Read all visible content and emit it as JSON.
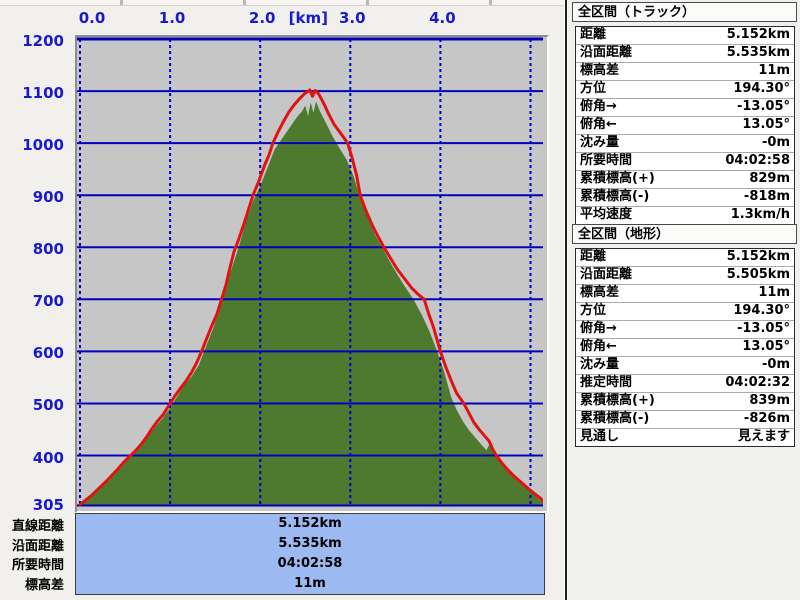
{
  "chart_data": {
    "type": "area",
    "title": "",
    "x_axis": {
      "unit_label": "[km]",
      "tick_labels": [
        "0.0",
        "1.0",
        "2.0",
        "3.0",
        "4.0"
      ],
      "tick_values": [
        0,
        1,
        2,
        3,
        4
      ],
      "gridline_values": [
        0,
        1,
        2,
        3,
        4,
        5
      ],
      "range_km": [
        0,
        5.17
      ]
    },
    "y_axis": {
      "unit": "m",
      "tick_labels": [
        "1200",
        "1100",
        "1000",
        "900",
        "800",
        "700",
        "600",
        "500",
        "400"
      ],
      "tick_values": [
        1200,
        1100,
        1000,
        900,
        800,
        700,
        600,
        500,
        400
      ],
      "base_label": "305",
      "range_m": [
        305,
        1200
      ]
    },
    "grid": true,
    "legend": "none",
    "series": [
      {
        "name": "terrain-profile",
        "type": "area",
        "color": "#4e7a30",
        "points": [
          [
            0.0,
            305
          ],
          [
            0.08,
            313
          ],
          [
            0.15,
            324
          ],
          [
            0.22,
            336
          ],
          [
            0.3,
            350
          ],
          [
            0.38,
            362
          ],
          [
            0.45,
            376
          ],
          [
            0.52,
            390
          ],
          [
            0.6,
            403
          ],
          [
            0.68,
            418
          ],
          [
            0.76,
            438
          ],
          [
            0.84,
            456
          ],
          [
            0.92,
            472
          ],
          [
            1.0,
            492
          ],
          [
            1.08,
            514
          ],
          [
            1.16,
            536
          ],
          [
            1.24,
            552
          ],
          [
            1.32,
            574
          ],
          [
            1.4,
            610
          ],
          [
            1.48,
            645
          ],
          [
            1.56,
            688
          ],
          [
            1.64,
            738
          ],
          [
            1.7,
            768
          ],
          [
            1.76,
            800
          ],
          [
            1.84,
            848
          ],
          [
            1.92,
            888
          ],
          [
            2.0,
            918
          ],
          [
            2.08,
            952
          ],
          [
            2.16,
            988
          ],
          [
            2.24,
            1008
          ],
          [
            2.32,
            1028
          ],
          [
            2.4,
            1048
          ],
          [
            2.46,
            1060
          ],
          [
            2.5,
            1072
          ],
          [
            2.53,
            1052
          ],
          [
            2.56,
            1078
          ],
          [
            2.59,
            1058
          ],
          [
            2.62,
            1080
          ],
          [
            2.66,
            1062
          ],
          [
            2.72,
            1042
          ],
          [
            2.8,
            1014
          ],
          [
            2.88,
            990
          ],
          [
            2.96,
            968
          ],
          [
            3.04,
            935
          ],
          [
            3.12,
            888
          ],
          [
            3.2,
            855
          ],
          [
            3.28,
            822
          ],
          [
            3.36,
            798
          ],
          [
            3.44,
            772
          ],
          [
            3.52,
            748
          ],
          [
            3.6,
            726
          ],
          [
            3.7,
            700
          ],
          [
            3.8,
            668
          ],
          [
            3.88,
            638
          ],
          [
            3.96,
            602
          ],
          [
            4.04,
            562
          ],
          [
            4.12,
            512
          ],
          [
            4.18,
            488
          ],
          [
            4.25,
            466
          ],
          [
            4.32,
            448
          ],
          [
            4.4,
            432
          ],
          [
            4.46,
            420
          ],
          [
            4.51,
            410
          ],
          [
            4.55,
            424
          ],
          [
            4.6,
            402
          ],
          [
            4.66,
            390
          ],
          [
            4.74,
            376
          ],
          [
            4.82,
            362
          ],
          [
            4.9,
            348
          ],
          [
            4.98,
            334
          ],
          [
            5.06,
            322
          ],
          [
            5.15,
            308
          ]
        ]
      },
      {
        "name": "track-profile",
        "type": "line",
        "color": "#e01212",
        "points": [
          [
            0.0,
            306
          ],
          [
            0.06,
            314
          ],
          [
            0.12,
            322
          ],
          [
            0.18,
            332
          ],
          [
            0.24,
            342
          ],
          [
            0.3,
            352
          ],
          [
            0.36,
            363
          ],
          [
            0.42,
            374
          ],
          [
            0.48,
            386
          ],
          [
            0.56,
            400
          ],
          [
            0.62,
            410
          ],
          [
            0.68,
            422
          ],
          [
            0.74,
            436
          ],
          [
            0.8,
            452
          ],
          [
            0.86,
            466
          ],
          [
            0.92,
            478
          ],
          [
            1.0,
            500
          ],
          [
            1.06,
            516
          ],
          [
            1.12,
            530
          ],
          [
            1.18,
            544
          ],
          [
            1.24,
            560
          ],
          [
            1.3,
            580
          ],
          [
            1.35,
            600
          ],
          [
            1.4,
            622
          ],
          [
            1.46,
            648
          ],
          [
            1.52,
            672
          ],
          [
            1.57,
            700
          ],
          [
            1.62,
            728
          ],
          [
            1.66,
            758
          ],
          [
            1.71,
            792
          ],
          [
            1.76,
            815
          ],
          [
            1.82,
            845
          ],
          [
            1.88,
            878
          ],
          [
            1.92,
            900
          ],
          [
            1.98,
            925
          ],
          [
            2.05,
            958
          ],
          [
            2.1,
            978
          ],
          [
            2.14,
            1000
          ],
          [
            2.2,
            1022
          ],
          [
            2.26,
            1042
          ],
          [
            2.32,
            1060
          ],
          [
            2.38,
            1074
          ],
          [
            2.44,
            1086
          ],
          [
            2.5,
            1096
          ],
          [
            2.55,
            1102
          ],
          [
            2.58,
            1090
          ],
          [
            2.61,
            1101
          ],
          [
            2.65,
            1094
          ],
          [
            2.7,
            1078
          ],
          [
            2.76,
            1056
          ],
          [
            2.82,
            1036
          ],
          [
            2.88,
            1022
          ],
          [
            2.93,
            1010
          ],
          [
            2.97,
            1000
          ],
          [
            3.02,
            972
          ],
          [
            3.07,
            938
          ],
          [
            3.11,
            900
          ],
          [
            3.17,
            872
          ],
          [
            3.24,
            844
          ],
          [
            3.31,
            820
          ],
          [
            3.38,
            798
          ],
          [
            3.45,
            778
          ],
          [
            3.52,
            758
          ],
          [
            3.6,
            740
          ],
          [
            3.68,
            722
          ],
          [
            3.75,
            710
          ],
          [
            3.82,
            700
          ],
          [
            3.87,
            672
          ],
          [
            3.92,
            648
          ],
          [
            3.97,
            618
          ],
          [
            4.0,
            600
          ],
          [
            4.06,
            570
          ],
          [
            4.12,
            544
          ],
          [
            4.18,
            520
          ],
          [
            4.26,
            500
          ],
          [
            4.31,
            484
          ],
          [
            4.37,
            464
          ],
          [
            4.43,
            450
          ],
          [
            4.49,
            438
          ],
          [
            4.54,
            428
          ],
          [
            4.58,
            412
          ],
          [
            4.62,
            400
          ],
          [
            4.68,
            386
          ],
          [
            4.75,
            372
          ],
          [
            4.82,
            360
          ],
          [
            4.9,
            348
          ],
          [
            4.98,
            336
          ],
          [
            5.05,
            326
          ],
          [
            5.11,
            318
          ],
          [
            5.15,
            312
          ]
        ]
      }
    ],
    "grid_color": "#0000bd",
    "plot_background": "#c6c6c6"
  },
  "bottom_summary": {
    "rows": [
      {
        "label": "直線距離",
        "value": "5.152km"
      },
      {
        "label": "沿面距離",
        "value": "5.535km"
      },
      {
        "label": "所要時間",
        "value": "04:02:58"
      },
      {
        "label": "標高差",
        "value": "11m"
      }
    ]
  },
  "panels": [
    {
      "title": "全区間（トラック）",
      "rows": [
        {
          "label": "距離",
          "value": "5.152km"
        },
        {
          "label": "沿面距離",
          "value": "5.535km"
        },
        {
          "label": "標高差",
          "value": "11m"
        },
        {
          "label": "方位",
          "value": "194.30°"
        },
        {
          "label": "俯角→",
          "value": "-13.05°"
        },
        {
          "label": "俯角←",
          "value": "13.05°"
        },
        {
          "label": "沈み量",
          "value": "-0m"
        },
        {
          "label": "所要時間",
          "value": "04:02:58"
        },
        {
          "label": "累積標高(+)",
          "value": "829m"
        },
        {
          "label": "累積標高(-)",
          "value": "-818m"
        },
        {
          "label": "平均速度",
          "value": "1.3km/h"
        }
      ]
    },
    {
      "title": "全区間（地形）",
      "rows": [
        {
          "label": "距離",
          "value": "5.152km"
        },
        {
          "label": "沿面距離",
          "value": "5.505km"
        },
        {
          "label": "標高差",
          "value": "11m"
        },
        {
          "label": "方位",
          "value": "194.30°"
        },
        {
          "label": "俯角→",
          "value": "-13.05°"
        },
        {
          "label": "俯角←",
          "value": "13.05°"
        },
        {
          "label": "沈み量",
          "value": "-0m"
        },
        {
          "label": "推定時間",
          "value": "04:02:32"
        },
        {
          "label": "累積標高(+)",
          "value": "839m"
        },
        {
          "label": "累積標高(-)",
          "value": "-826m"
        },
        {
          "label": "見通し",
          "value": "見えます"
        }
      ]
    }
  ],
  "colors": {
    "axis_label_blue": "#1a1acd",
    "grid_blue": "#0000bd",
    "terrain_green": "#4e7a30",
    "track_red": "#e01212",
    "summary_box_blue": "#9db9f2",
    "plot_gray": "#c6c6c6"
  }
}
